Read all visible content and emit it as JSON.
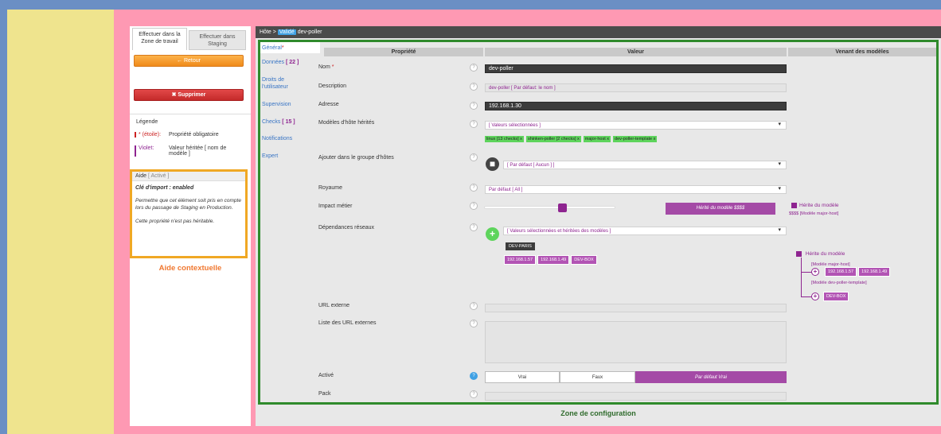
{
  "left": {
    "tab_workspace": "Effectuer dans la Zone de travail",
    "tab_staging": "Effectuer dans Staging",
    "back_label": "← Retour",
    "delete_label": "✖ Supprimer",
    "legend_title": "Légende",
    "legend": [
      {
        "key": "* (étoile):",
        "value": "Propriété obligatoire"
      },
      {
        "key": "Violet:",
        "value": "Valeur héritée [ nom de modèle ]"
      }
    ],
    "help_title": "Aide",
    "help_state": "[ Activé ]",
    "help_key": "Clé d'import : enabled",
    "help_p1": "Permettre que cet élément soit pris en compte lors du passage de Staging en Production.",
    "help_p2": "Cette propriété n'est pas héritable.",
    "context_help_label": "Aide contextuelle"
  },
  "breadcrumb": {
    "prefix": "Hôte >",
    "badge": "Validé",
    "name": "dev-poller"
  },
  "nav": [
    {
      "label": "Général",
      "mark": "*",
      "count": ""
    },
    {
      "label": "Données",
      "mark": "",
      "count": "[ 22 ]"
    },
    {
      "label": "Droits de l'utilisateur",
      "mark": "",
      "count": ""
    },
    {
      "label": "Supervision",
      "mark": "",
      "count": ""
    },
    {
      "label": "Checks",
      "mark": "",
      "count": "[ 15 ]"
    },
    {
      "label": "Notifications",
      "mark": "",
      "count": ""
    },
    {
      "label": "Expert",
      "mark": "",
      "count": ""
    }
  ],
  "headers": {
    "property": "Propriété",
    "value": "Valeur",
    "from_models": "Venant des modèles"
  },
  "fields": {
    "nom": {
      "label": "Nom",
      "mark": "*",
      "value": "dev-poller"
    },
    "description": {
      "label": "Description",
      "placeholder": "dev-poller [ Par défaut: le nom ]"
    },
    "adresse": {
      "label": "Adresse",
      "value": "192.168.1.30"
    },
    "modeles": {
      "label": "Modèles d'hôte hérités",
      "select": "[ Valeurs sélectionnées ]",
      "tags": [
        "linux [13 checks] x",
        "shinken-poller [2 checks] x",
        "major-host x",
        "dev-poller-template x"
      ]
    },
    "groupe": {
      "label": "Ajouter dans le groupe d'hôtes",
      "select": "[ Par défaut [ Aucun ] ]"
    },
    "royaume": {
      "label": "Royaume",
      "select": "Par défaut [ All ]"
    },
    "impact": {
      "label": "Impact métier",
      "level_fraction": 0.6,
      "inherited_btn": "Hérité du modèle $$$$",
      "inherit_label": "Hérite du modèle",
      "inherit_note": "$$$$ [Modèle major-host]"
    },
    "dependances": {
      "label": "Dépendances réseaux",
      "select": "[ Valeurs sélectionnées et héritées des modèles ]",
      "dark_tag": "DEV-PARIS",
      "tags": [
        "192.168.1.57",
        "192.168.1.49",
        "DEV-BOX"
      ]
    },
    "url": {
      "label": "URL externe"
    },
    "liste_url": {
      "label": "Liste des URL externes"
    },
    "active": {
      "label": "Activé",
      "options": [
        "Vrai",
        "Faux",
        "Par défaut Vrai"
      ]
    },
    "pack": {
      "label": "Pack"
    }
  },
  "tree": {
    "inherit_label": "Hérite du modèle",
    "model1": "[Modèle major-host]",
    "model1_tags": [
      "192.168.1.57",
      "192.168.1.49"
    ],
    "model2": "[Modèle dev-poller-template]",
    "model2_tags": [
      "DEV-BOX"
    ]
  },
  "zone_label": "Zone de configuration",
  "colors": {
    "pink": "#fe99b3",
    "yellow": "#efe48e",
    "blue": "#6b8fc4",
    "green_border": "#2f8a2c",
    "purple": "#8e2490"
  }
}
